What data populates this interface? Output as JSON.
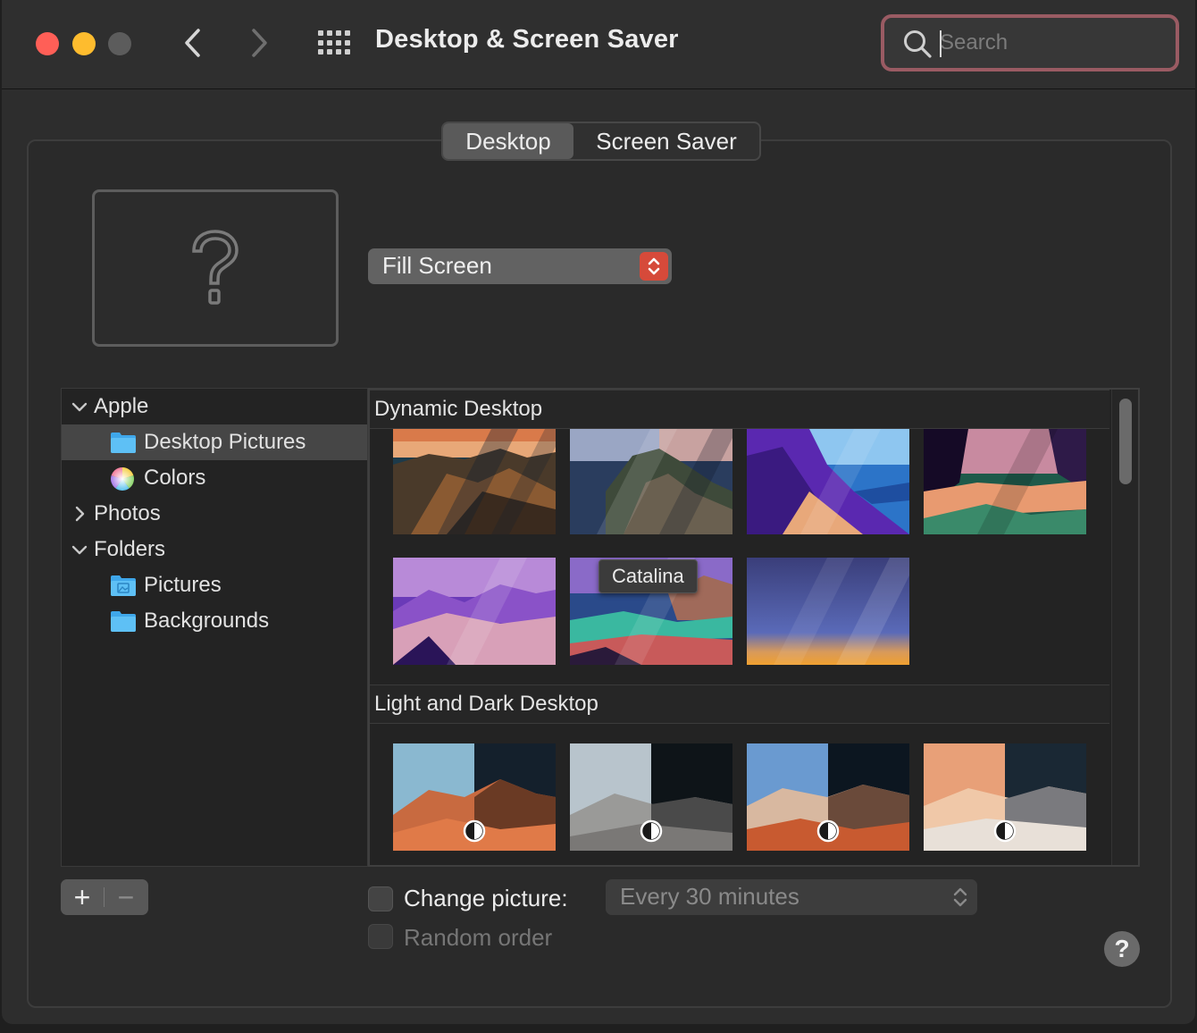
{
  "window": {
    "title": "Desktop & Screen Saver"
  },
  "search": {
    "placeholder": "Search",
    "value": ""
  },
  "tabs": [
    {
      "label": "Desktop",
      "selected": true
    },
    {
      "label": "Screen Saver",
      "selected": false
    }
  ],
  "preview": {
    "icon": "question-mark-icon"
  },
  "fit_popup": {
    "value": "Fill Screen"
  },
  "sidebar": {
    "items": [
      {
        "label": "Apple",
        "type": "group",
        "expanded": true
      },
      {
        "label": "Desktop Pictures",
        "type": "folder",
        "selected": true
      },
      {
        "label": "Colors",
        "type": "colors"
      },
      {
        "label": "Photos",
        "type": "group",
        "expanded": false
      },
      {
        "label": "Folders",
        "type": "group",
        "expanded": true
      },
      {
        "label": "Pictures",
        "type": "pictures-folder"
      },
      {
        "label": "Backgrounds",
        "type": "folder"
      }
    ]
  },
  "sections": [
    {
      "title": "Dynamic Desktop"
    },
    {
      "title": "Light and Dark Desktop"
    }
  ],
  "tooltip": {
    "text": "Catalina"
  },
  "bottom": {
    "add_label": "+",
    "remove_label": "−",
    "change_picture": {
      "label": "Change picture:",
      "checked": false
    },
    "interval": {
      "value": "Every 30 minutes",
      "enabled": false
    },
    "random_order": {
      "label": "Random order",
      "checked": false,
      "enabled": false
    },
    "help_label": "?"
  },
  "colors": {
    "close": "#ff5f57",
    "minimize": "#febc2e",
    "search_focus_ring": "#9a5b63",
    "popup_accent": "#d64a3a"
  }
}
